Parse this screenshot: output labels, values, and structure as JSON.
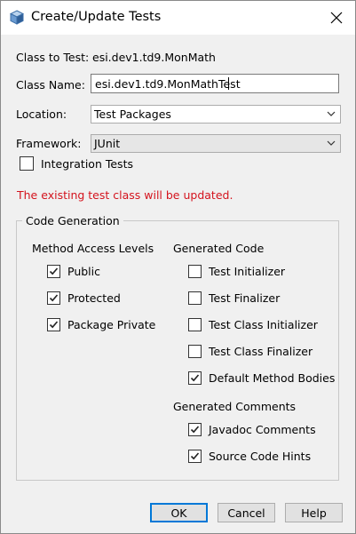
{
  "dialog": {
    "title": "Create/Update Tests",
    "close_icon": "close-icon",
    "app_icon": "cube-icon"
  },
  "form": {
    "class_to_test_label": "Class to Test:",
    "class_to_test_value": "esi.dev1.td9.MonMath",
    "class_name_label": "Class Name:",
    "class_name_value": "esi.dev1.td9.MonMathTest",
    "location_label": "Location:",
    "location_value": "Test Packages",
    "framework_label": "Framework:",
    "framework_value": "JUnit",
    "integration_tests_label": "Integration Tests",
    "integration_tests_checked": false
  },
  "warning_message": "The existing test class will be updated.",
  "code_generation": {
    "legend": "Code Generation",
    "method_access_levels": {
      "heading": "Method Access Levels",
      "items": [
        {
          "label": "Public",
          "checked": true
        },
        {
          "label": "Protected",
          "checked": true
        },
        {
          "label": "Package Private",
          "checked": true
        }
      ]
    },
    "generated_code": {
      "heading": "Generated Code",
      "items": [
        {
          "label": "Test Initializer",
          "checked": false
        },
        {
          "label": "Test Finalizer",
          "checked": false
        },
        {
          "label": "Test Class Initializer",
          "checked": false
        },
        {
          "label": "Test Class Finalizer",
          "checked": false
        },
        {
          "label": "Default Method Bodies",
          "checked": true
        }
      ]
    },
    "generated_comments": {
      "heading": "Generated Comments",
      "items": [
        {
          "label": "Javadoc Comments",
          "checked": true
        },
        {
          "label": "Source Code Hints",
          "checked": true
        }
      ]
    }
  },
  "buttons": {
    "ok": "OK",
    "cancel": "Cancel",
    "help": "Help"
  },
  "colors": {
    "warning": "#d4131d",
    "primary_button_border": "#0078d7"
  }
}
